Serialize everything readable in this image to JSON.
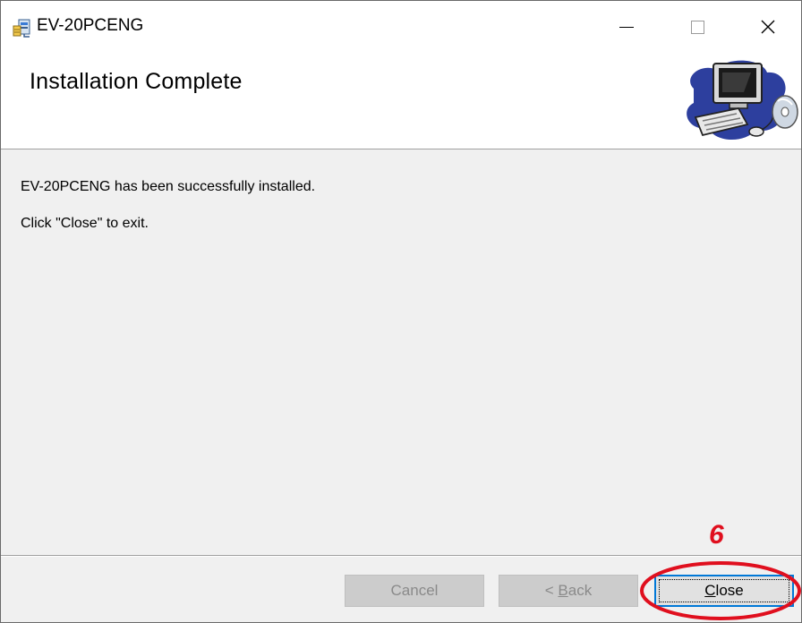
{
  "window": {
    "title": "EV-20PCENG",
    "controls": {
      "minimize_glyph": "—",
      "maximize_glyph": "☐",
      "close_glyph": "✕"
    }
  },
  "header": {
    "title": "Installation Complete",
    "art_icon": "computer-setup-icon"
  },
  "content": {
    "line1": "EV-20PCENG has been successfully installed.",
    "line2": "Click \"Close\" to exit."
  },
  "buttons": {
    "cancel": "Cancel",
    "back_prefix": "< ",
    "back_access": "B",
    "back_rest": "ack",
    "close_access": "C",
    "close_rest": "lose"
  },
  "annotation": {
    "step_number": "6",
    "color": "#e00f1e"
  },
  "colors": {
    "accent": "#0078d7",
    "dialog_bg": "#f0f0f0",
    "disabled_button": "#cccccc"
  }
}
